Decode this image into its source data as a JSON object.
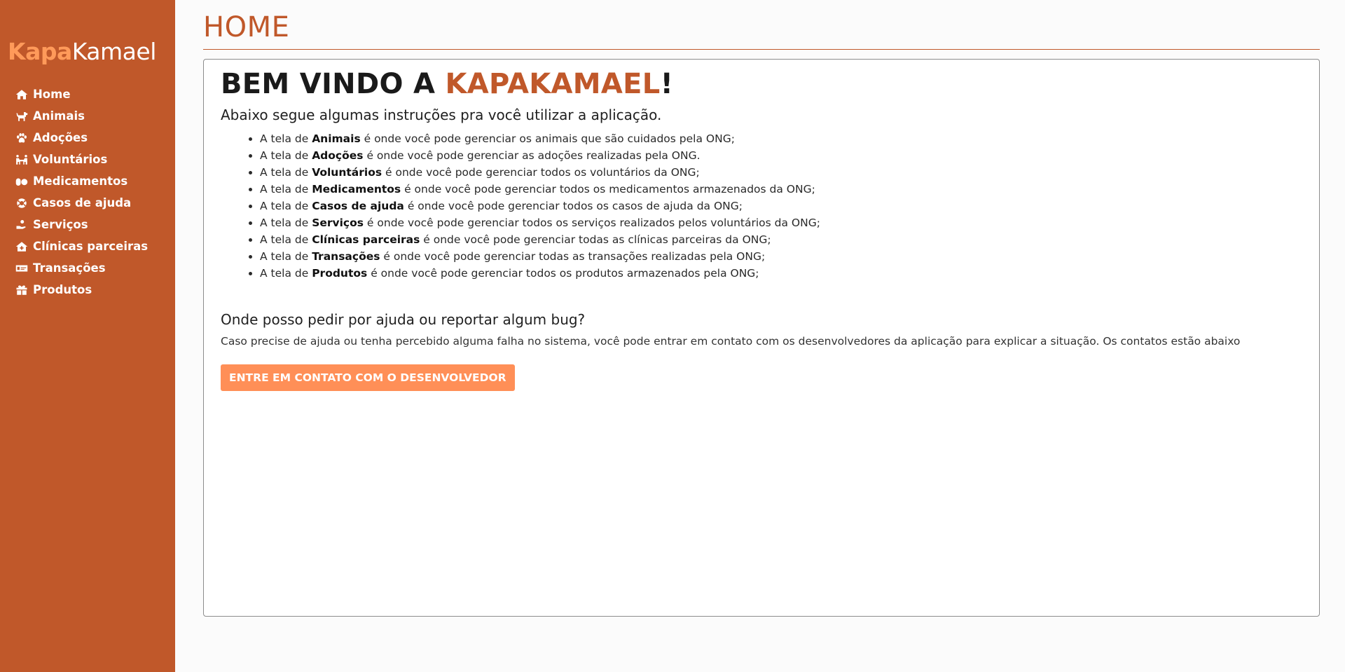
{
  "brand": {
    "part1": "Kapa",
    "part2": "Kamael"
  },
  "sidebar": {
    "items": [
      {
        "label": "Home",
        "icon": "home-icon"
      },
      {
        "label": "Animais",
        "icon": "dog-icon"
      },
      {
        "label": "Adoções",
        "icon": "paw-icon"
      },
      {
        "label": "Voluntários",
        "icon": "people-carry-icon"
      },
      {
        "label": "Medicamentos",
        "icon": "pills-icon"
      },
      {
        "label": "Casos de ajuda",
        "icon": "life-ring-icon"
      },
      {
        "label": "Serviços",
        "icon": "hand-holding-icon"
      },
      {
        "label": "Clínicas parceiras",
        "icon": "clinic-house-icon"
      },
      {
        "label": "Transações",
        "icon": "money-bill-icon"
      },
      {
        "label": "Produtos",
        "icon": "box-icon"
      }
    ]
  },
  "header": {
    "title": "HOME"
  },
  "welcome": {
    "prefix": "BEM VINDO A ",
    "accent": "KAPAKAMAEL",
    "suffix": "!"
  },
  "intro": "Abaixo segue algumas instruções pra você utilizar a aplicação.",
  "instructions": [
    {
      "pre": "A tela de ",
      "bold": "Animais",
      "rest": " é onde você pode gerenciar os animais que são cuidados pela ONG;"
    },
    {
      "pre": "A tela de ",
      "bold": "Adoções",
      "rest": " é onde você pode gerenciar as adoções realizadas pela ONG."
    },
    {
      "pre": "A tela de ",
      "bold": "Voluntários",
      "rest": " é onde você pode gerenciar todos os voluntários da ONG;"
    },
    {
      "pre": "A tela de ",
      "bold": "Medicamentos",
      "rest": " é onde você pode gerenciar todos os medicamentos armazenados da ONG;"
    },
    {
      "pre": "A tela de ",
      "bold": "Casos de ajuda",
      "rest": " é onde você pode gerenciar todos os casos de ajuda da ONG;"
    },
    {
      "pre": "A tela de ",
      "bold": "Serviços",
      "rest": " é onde você pode gerenciar todos os serviços realizados pelos voluntários da ONG;"
    },
    {
      "pre": "A tela de ",
      "bold": "Clínicas parceiras",
      "rest": " é onde você pode gerenciar todas as clínicas parceiras da ONG;"
    },
    {
      "pre": "A tela de ",
      "bold": "Transações",
      "rest": " é onde você pode gerenciar todas as transações realizadas pela ONG;"
    },
    {
      "pre": "A tela de ",
      "bold": "Produtos",
      "rest": " é onde você pode gerenciar todos os produtos armazenados pela ONG;"
    }
  ],
  "help": {
    "title": "Onde posso pedir por ajuda ou reportar algum bug?",
    "text": "Caso precise de ajuda ou tenha percebido alguma falha no sistema, você pode entrar em contato com os desenvolvedores da aplicação para explicar a situação. Os contatos estão abaixo",
    "button_label": "ENTRE EM CONTATO COM O DESENVOLVEDOR"
  },
  "colors": {
    "sidebar": "#c0582a",
    "brand_accent": "#ff9a5a",
    "button": "#ff8f57",
    "title": "#c0582a"
  }
}
